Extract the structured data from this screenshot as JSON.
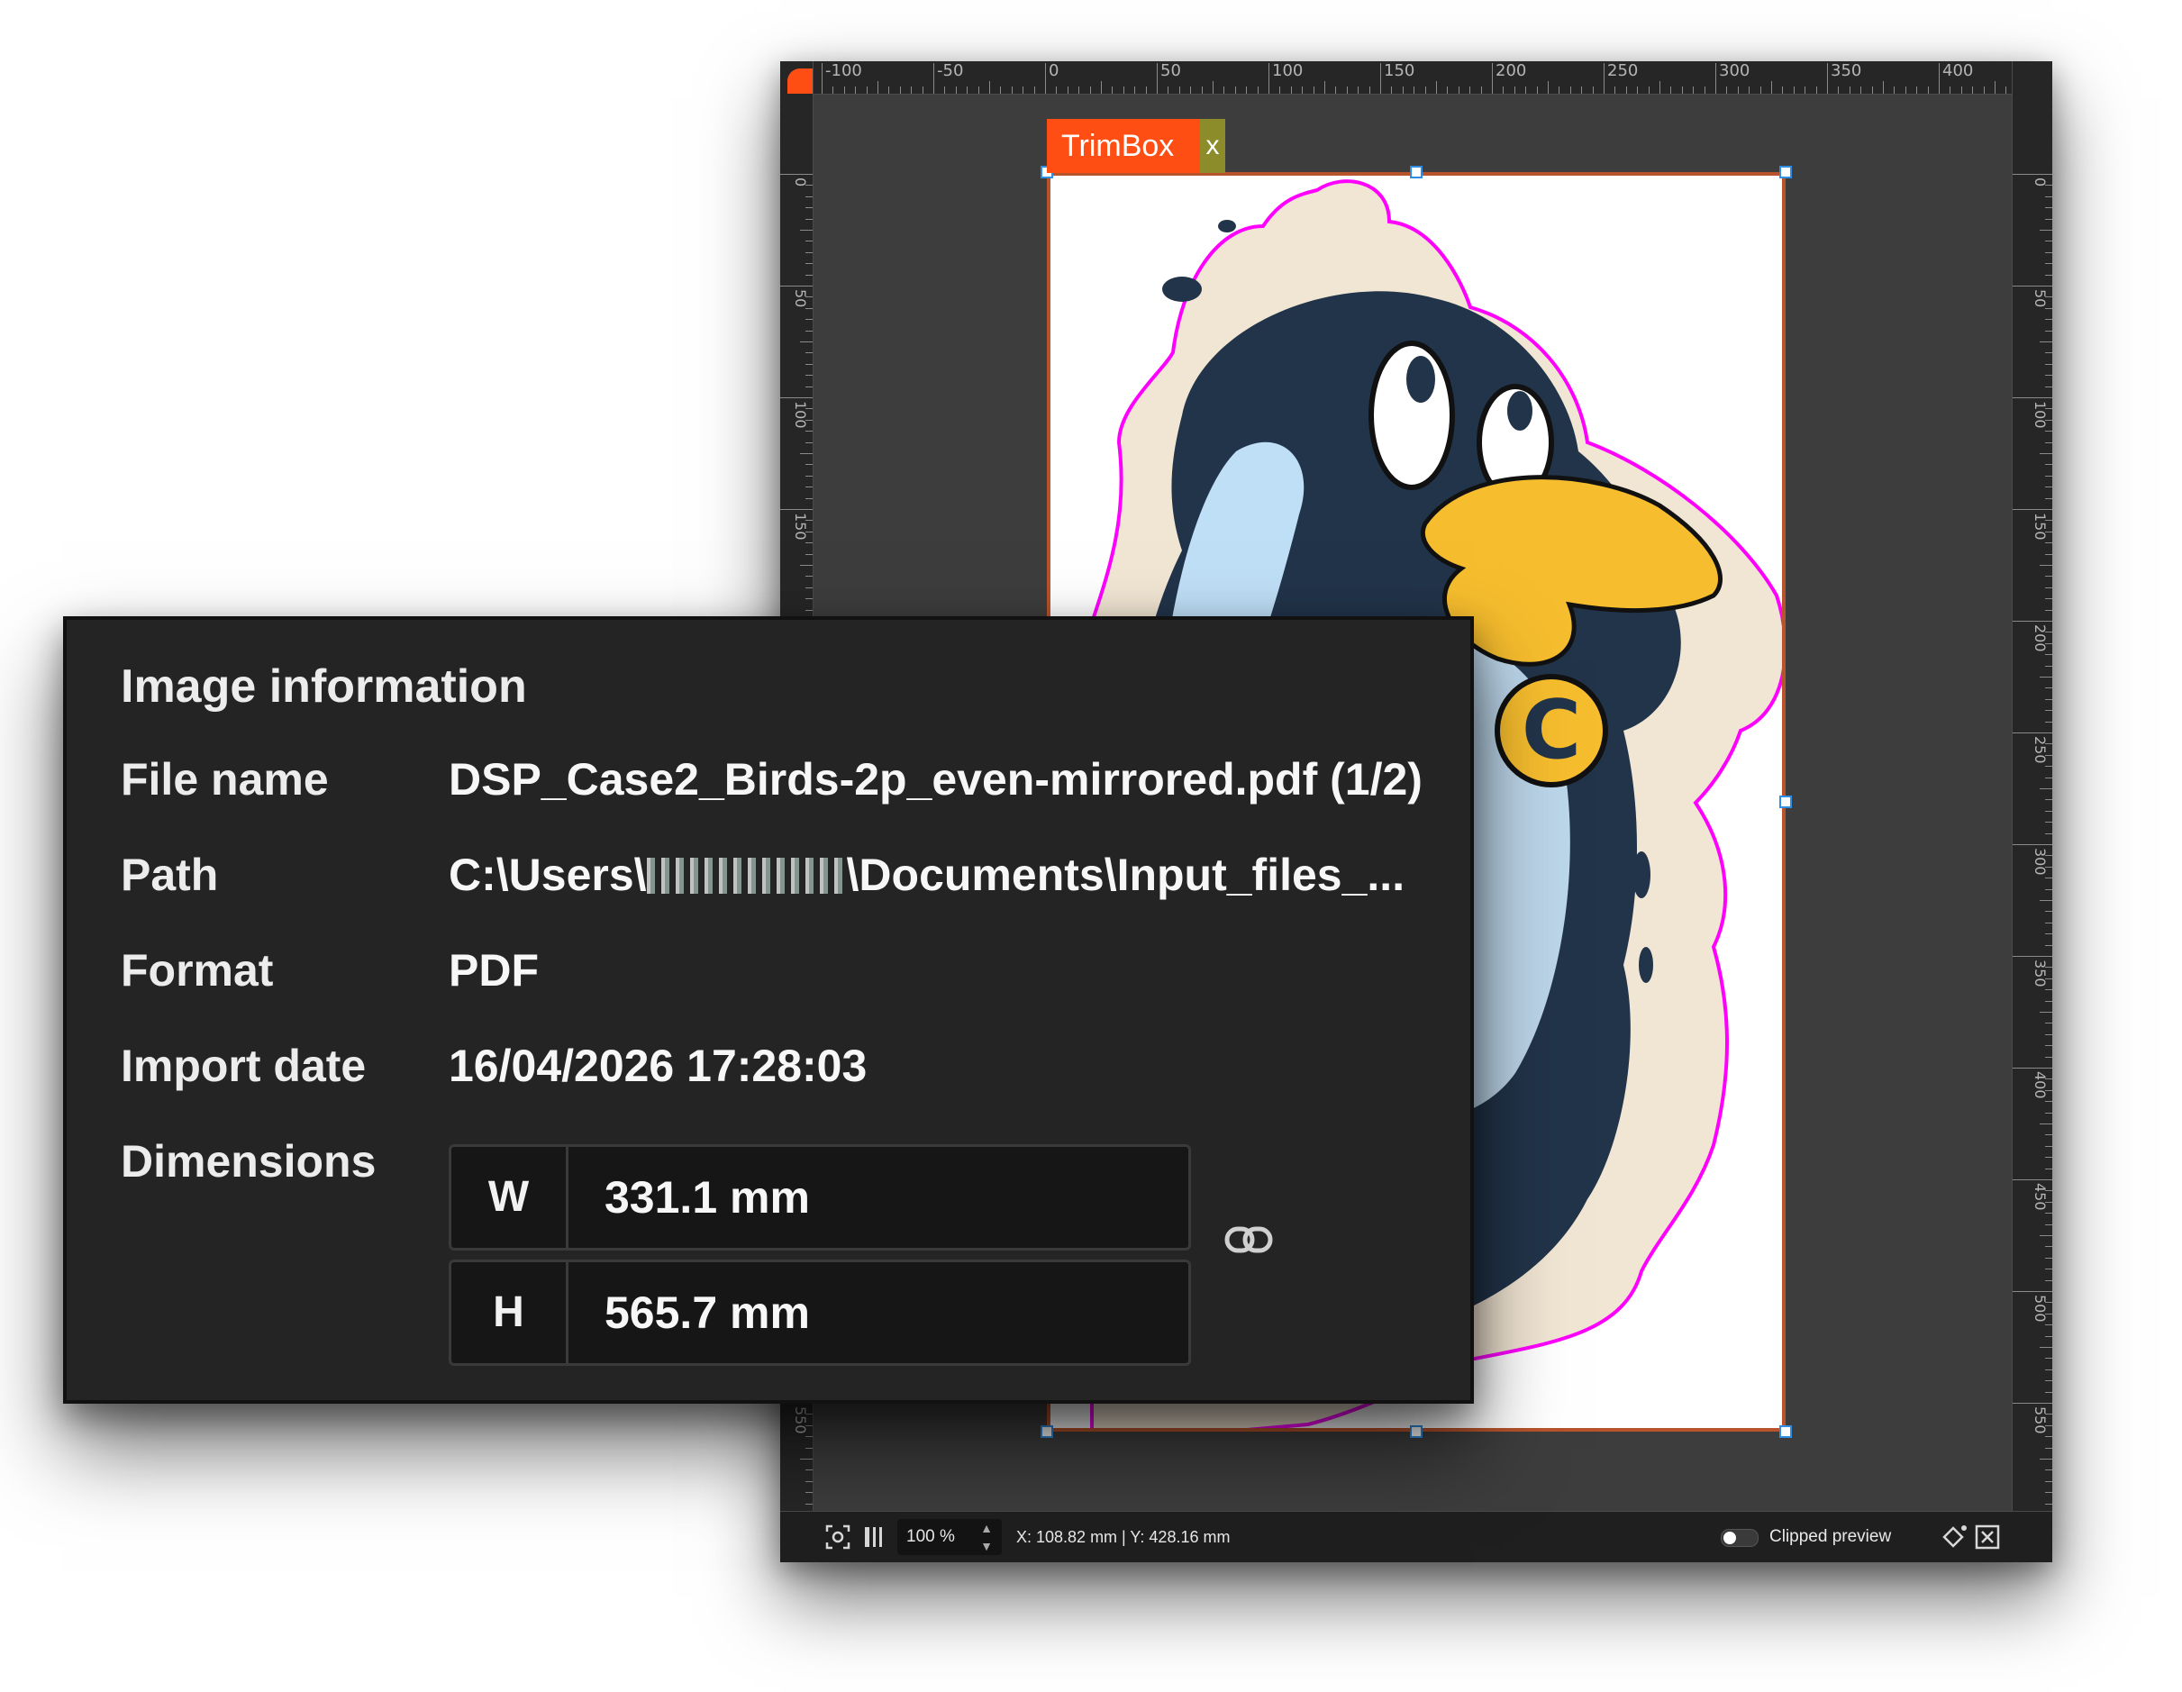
{
  "canvas": {
    "ruler_top_labels": [
      "-100",
      "-50",
      "0",
      "50",
      "100",
      "150",
      "200",
      "250",
      "300",
      "350",
      "400"
    ],
    "ruler_left_labels": [
      "0",
      "50",
      "100",
      "150",
      "550"
    ],
    "ruler_right_labels": [
      "0",
      "50",
      "100",
      "150",
      "200",
      "250",
      "300",
      "350",
      "400",
      "450",
      "500",
      "550"
    ],
    "trimbox_label": "TrimBox",
    "trimbox_tail": "x",
    "colors": {
      "accent": "#ff4e14",
      "trim_border": "#b8532c",
      "cutline": "#ff00ff",
      "handle": "#2f8de4"
    }
  },
  "statusbar": {
    "fit_icon": "fit-screen-icon",
    "split_icon": "split-view-icon",
    "zoom": "100 %",
    "coordinates": "X: 108.82 mm | Y: 428.16 mm",
    "clipped_preview": "Clipped preview",
    "clipped_preview_on": false,
    "paint_icon": "paint-bucket-icon",
    "close_icon": "close-box-icon"
  },
  "info": {
    "title": "Image information",
    "file_name_label": "File name",
    "file_name": "DSP_Case2_Birds-2p_even-mirrored.pdf (1/2)",
    "path_label": "Path",
    "path_prefix": "C:\\Users\\",
    "path_suffix": "\\Documents\\Input_files_...",
    "format_label": "Format",
    "format": "PDF",
    "import_date_label": "Import date",
    "import_date": "16/04/2026 17:28:03",
    "dimensions_label": "Dimensions",
    "width_key": "W",
    "width": "331.1 mm",
    "height_key": "H",
    "height": "565.7 mm",
    "link_icon": "link-icon"
  }
}
